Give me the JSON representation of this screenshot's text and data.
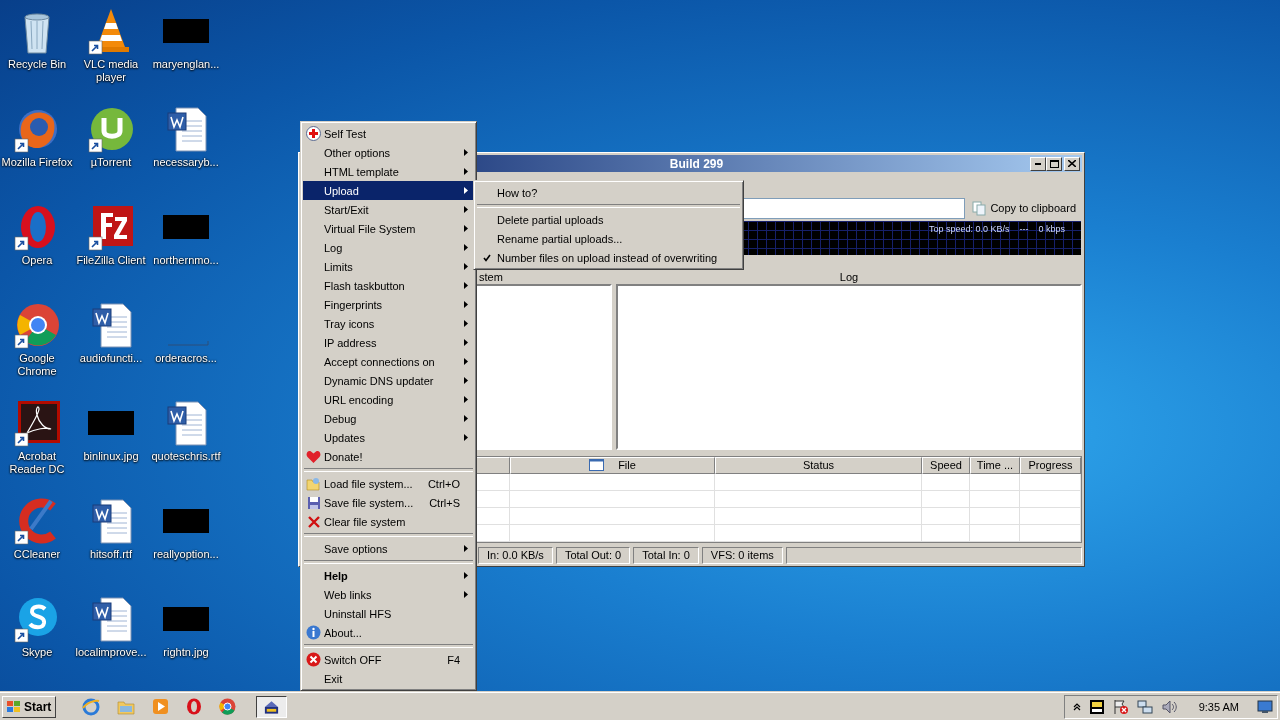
{
  "desktop_icons": [
    {
      "label": "Recycle Bin",
      "kind": "recycle",
      "shortcut": false
    },
    {
      "label": "VLC media player",
      "kind": "cone",
      "shortcut": true
    },
    {
      "label": "maryenglan...",
      "kind": "redacted",
      "shortcut": false
    },
    {
      "label": "Mozilla Firefox",
      "kind": "firefox",
      "shortcut": true
    },
    {
      "label": "µTorrent",
      "kind": "torrent",
      "shortcut": true
    },
    {
      "label": "necessaryb...",
      "kind": "word",
      "shortcut": false
    },
    {
      "label": "Opera",
      "kind": "opera",
      "shortcut": true
    },
    {
      "label": "FileZilla Client",
      "kind": "filezilla",
      "shortcut": true
    },
    {
      "label": "northernmo...",
      "kind": "redacted",
      "shortcut": false
    },
    {
      "label": "Google Chrome",
      "kind": "chrome",
      "shortcut": true
    },
    {
      "label": "audiofuncti...",
      "kind": "word",
      "shortcut": false
    },
    {
      "label": "orderacros...",
      "kind": "blank",
      "shortcut": false
    },
    {
      "label": "Acrobat Reader DC",
      "kind": "acrobat",
      "shortcut": true
    },
    {
      "label": "binlinux.jpg",
      "kind": "redacted",
      "shortcut": false
    },
    {
      "label": "quoteschris.rtf",
      "kind": "word",
      "shortcut": false
    },
    {
      "label": "CCleaner",
      "kind": "ccleaner",
      "shortcut": true
    },
    {
      "label": "hitsoff.rtf",
      "kind": "word",
      "shortcut": false
    },
    {
      "label": "reallyoption...",
      "kind": "redacted",
      "shortcut": false
    },
    {
      "label": "Skype",
      "kind": "skype",
      "shortcut": true
    },
    {
      "label": "localimprove...",
      "kind": "word",
      "shortcut": false
    },
    {
      "label": "rightn.jpg",
      "kind": "redacted",
      "shortcut": false
    }
  ],
  "window": {
    "title": "Build 299",
    "copy_button": "Copy to clipboard",
    "graph": {
      "top_speed": "Top speed: 0.0 KB/s",
      "separator": "---",
      "rate": "0 kbps"
    },
    "panels": {
      "files_header": "stem",
      "log_header": "Log"
    },
    "transfer_columns": [
      "File",
      "Status",
      "Speed",
      "Time ...",
      "Progress"
    ],
    "status_bar": [
      "In: 0.0 KB/s",
      "Total Out: 0",
      "Total In: 0",
      "VFS: 0 items"
    ]
  },
  "menu": {
    "groups": [
      [
        {
          "label": "Self Test",
          "submenu": false,
          "selected": false,
          "bold": false
        },
        {
          "label": "Other options",
          "submenu": true,
          "selected": false,
          "bold": false
        },
        {
          "label": "HTML template",
          "submenu": true,
          "selected": false,
          "bold": false
        },
        {
          "label": "Upload",
          "submenu": true,
          "selected": true,
          "bold": false
        },
        {
          "label": "Start/Exit",
          "submenu": true,
          "selected": false,
          "bold": false
        },
        {
          "label": "Virtual File System",
          "submenu": true,
          "selected": false,
          "bold": false
        },
        {
          "label": "Log",
          "submenu": true,
          "selected": false,
          "bold": false
        },
        {
          "label": "Limits",
          "submenu": true,
          "selected": false,
          "bold": false
        },
        {
          "label": "Flash taskbutton",
          "submenu": true,
          "selected": false,
          "bold": false
        },
        {
          "label": "Fingerprints",
          "submenu": true,
          "selected": false,
          "bold": false
        },
        {
          "label": "Tray icons",
          "submenu": true,
          "selected": false,
          "bold": false
        },
        {
          "label": "IP address",
          "submenu": true,
          "selected": false,
          "bold": false
        },
        {
          "label": "Accept connections on",
          "submenu": true,
          "selected": false,
          "bold": false
        },
        {
          "label": "Dynamic DNS updater",
          "submenu": true,
          "selected": false,
          "bold": false
        },
        {
          "label": "URL encoding",
          "submenu": true,
          "selected": false,
          "bold": false
        },
        {
          "label": "Debug",
          "submenu": true,
          "selected": false,
          "bold": false
        },
        {
          "label": "Updates",
          "submenu": true,
          "selected": false,
          "bold": false
        },
        {
          "label": "Donate!",
          "submenu": false,
          "selected": false,
          "bold": false
        }
      ],
      [
        {
          "label": "Load file system...",
          "shortcut": "Ctrl+O",
          "submenu": false,
          "selected": false,
          "bold": false
        },
        {
          "label": "Save file system...",
          "shortcut": "Ctrl+S",
          "submenu": false,
          "selected": false,
          "bold": false
        },
        {
          "label": "Clear file system",
          "submenu": false,
          "selected": false,
          "bold": false
        }
      ],
      [
        {
          "label": "Save options",
          "submenu": true,
          "selected": false,
          "bold": false
        }
      ],
      [
        {
          "label": "Help",
          "submenu": true,
          "selected": false,
          "bold": true
        },
        {
          "label": "Web links",
          "submenu": true,
          "selected": false,
          "bold": false
        },
        {
          "label": "Uninstall HFS",
          "submenu": false,
          "selected": false,
          "bold": false
        },
        {
          "label": "About...",
          "submenu": false,
          "selected": false,
          "bold": false
        }
      ],
      [
        {
          "label": "Switch OFF",
          "shortcut": "F4",
          "submenu": false,
          "selected": false,
          "bold": false
        },
        {
          "label": "Exit",
          "submenu": false,
          "selected": false,
          "bold": false
        }
      ]
    ]
  },
  "submenu": {
    "groups": [
      [
        {
          "label": "How to?",
          "checked": false
        }
      ],
      [
        {
          "label": "Delete partial uploads",
          "checked": false
        },
        {
          "label": "Rename partial uploads...",
          "checked": false
        },
        {
          "label": "Number files on upload instead of overwriting",
          "checked": true
        }
      ]
    ]
  },
  "taskbar": {
    "start": "Start",
    "task_button": {
      "pressed": true
    },
    "clock": "9:35 AM"
  }
}
